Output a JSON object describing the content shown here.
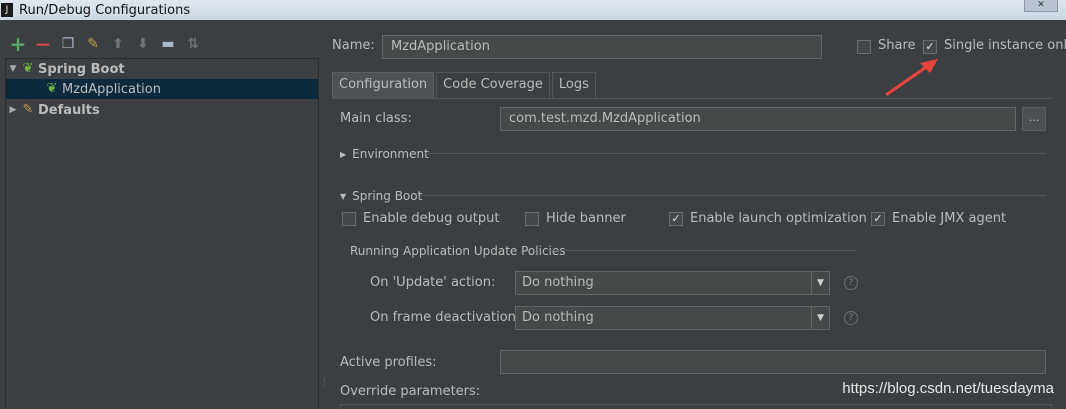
{
  "window": {
    "title": "Run/Debug Configurations",
    "app_icon": "J"
  },
  "toolbar": {
    "icons": [
      "add-icon",
      "remove-icon",
      "copy-icon",
      "wrench-icon",
      "arrow-up-icon",
      "arrow-down-icon",
      "folder-icon",
      "sort-icon"
    ]
  },
  "tree": {
    "items": [
      {
        "label": "Spring Boot",
        "expanded": true
      },
      {
        "label": "MzdApplication",
        "selected": true
      },
      {
        "label": "Defaults",
        "expanded": false
      }
    ]
  },
  "name_field": {
    "label": "Name:",
    "value": "MzdApplication"
  },
  "share": {
    "label": "Share",
    "checked": false
  },
  "single_instance": {
    "label": "Single instance only",
    "checked": true
  },
  "tabs": [
    {
      "label": "Configuration",
      "active": true
    },
    {
      "label": "Code Coverage",
      "active": false
    },
    {
      "label": "Logs",
      "active": false
    }
  ],
  "main_class": {
    "label": "Main class:",
    "value": "com.test.mzd.MzdApplication",
    "button_label": "..."
  },
  "environment": {
    "label": "Environment"
  },
  "spring_boot": {
    "label": "Spring Boot",
    "options": [
      {
        "label": "Enable debug output",
        "checked": false
      },
      {
        "label": "Hide banner",
        "checked": false
      },
      {
        "label": "Enable launch optimization",
        "checked": true
      },
      {
        "label": "Enable JMX agent",
        "checked": true
      }
    ]
  },
  "update_policies": {
    "label": "Running Application Update Policies",
    "on_update": {
      "label": "On 'Update' action:",
      "value": "Do nothing"
    },
    "on_frame": {
      "label": "On frame deactivation:",
      "value": "Do nothing"
    }
  },
  "active_profiles": {
    "label": "Active profiles:",
    "value": ""
  },
  "override_parameters": {
    "label": "Override parameters:"
  },
  "watermark": "https://blog.csdn.net/tuesdayma",
  "colors": {
    "background": "#3c3f41",
    "selection": "#0d293e",
    "accent_arrow": "#e8453c"
  }
}
